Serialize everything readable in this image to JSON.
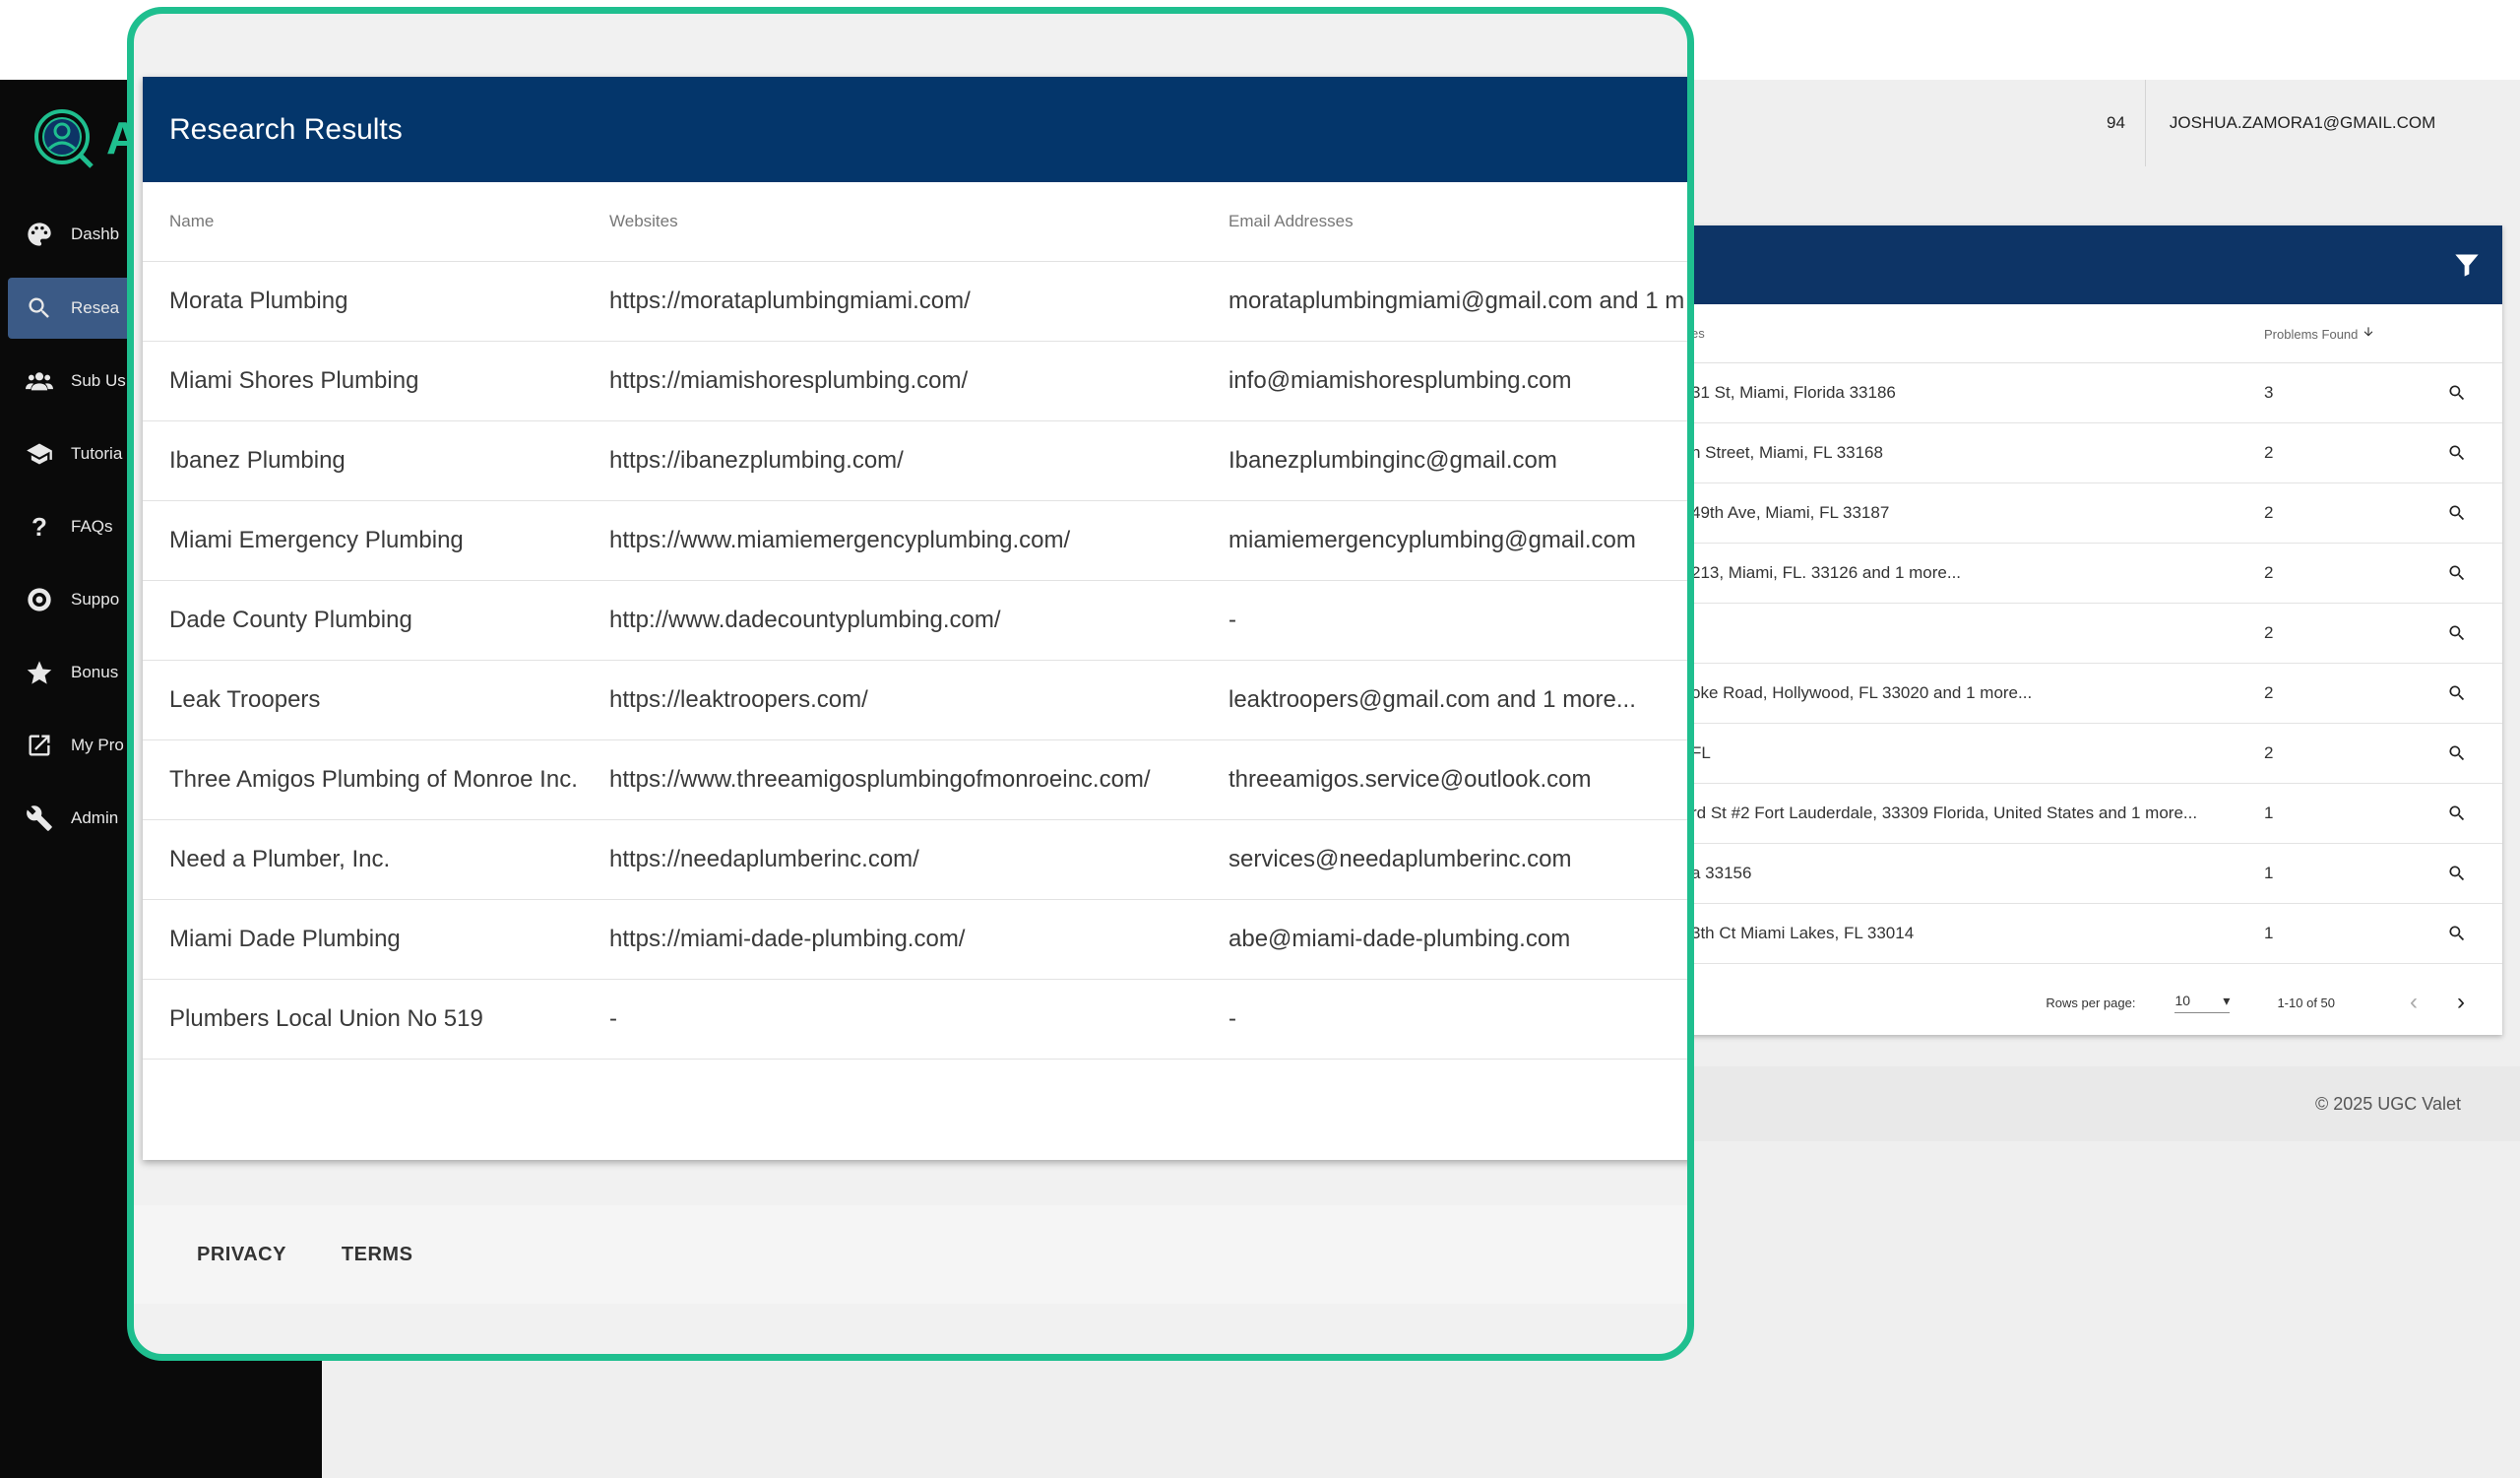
{
  "brand": {
    "logo_letter": "A",
    "accent_color": "#1fbf8f",
    "header_color": "#04366b"
  },
  "topbar": {
    "credits": "94",
    "user_email": "JOSHUA.ZAMORA1@GMAIL.COM"
  },
  "sidebar": {
    "items": [
      {
        "label": "Dashb",
        "icon": "palette-icon"
      },
      {
        "label": "Resea",
        "icon": "search-icon",
        "active": true
      },
      {
        "label": "Sub Us",
        "icon": "users-icon"
      },
      {
        "label": "Tutoria",
        "icon": "graduation-cap-icon"
      },
      {
        "label": "FAQs",
        "icon": "question-icon"
      },
      {
        "label": "Suppo",
        "icon": "lifebuoy-icon"
      },
      {
        "label": "Bonus",
        "icon": "star-icon"
      },
      {
        "label": "My Pro",
        "icon": "external-link-icon"
      },
      {
        "label": "Admin",
        "icon": "tools-icon"
      }
    ]
  },
  "background_table": {
    "col_address": "es",
    "col_problems": "Problems Found",
    "rows": [
      {
        "address": "31 St, Miami, Florida 33186",
        "problems": "3"
      },
      {
        "address": "h Street, Miami, FL 33168",
        "problems": "2"
      },
      {
        "address": "49th Ave, Miami, FL 33187",
        "problems": "2"
      },
      {
        "address": "213, Miami, FL. 33126 and 1 more...",
        "problems": "2"
      },
      {
        "address": "",
        "problems": "2"
      },
      {
        "address": "oke Road, Hollywood, FL 33020 and 1 more...",
        "problems": "2"
      },
      {
        "address": "FL",
        "problems": "2"
      },
      {
        "address": "rd St #2 Fort Lauderdale, 33309 Florida, United States and 1 more...",
        "problems": "1"
      },
      {
        "address": "a 33156",
        "problems": "1"
      },
      {
        "address": "3th Ct Miami Lakes, FL 33014",
        "problems": "1"
      }
    ],
    "pagination": {
      "rows_per_page_label": "Rows per page:",
      "rows_per_page": "10",
      "range": "1-10 of 50"
    },
    "copyright": "© 2025 UGC Valet"
  },
  "modal": {
    "title": "Research Results",
    "columns": {
      "name": "Name",
      "websites": "Websites",
      "emails": "Email Addresses"
    },
    "rows": [
      {
        "name": "Morata Plumbing",
        "website": "https://morataplumbingmiami.com/",
        "email": "morataplumbingmiami@gmail.com and 1 m"
      },
      {
        "name": "Miami Shores Plumbing",
        "website": "https://miamishoresplumbing.com/",
        "email": "info@miamishoresplumbing.com"
      },
      {
        "name": "Ibanez Plumbing",
        "website": "https://ibanezplumbing.com/",
        "email": "Ibanezplumbinginc@gmail.com"
      },
      {
        "name": "Miami Emergency Plumbing",
        "website": "https://www.miamiemergencyplumbing.com/",
        "email": "miamiemergencyplumbing@gmail.com"
      },
      {
        "name": "Dade County Plumbing",
        "website": "http://www.dadecountyplumbing.com/",
        "email": "-"
      },
      {
        "name": "Leak Troopers",
        "website": "https://leaktroopers.com/",
        "email": "leaktroopers@gmail.com and 1 more..."
      },
      {
        "name": "Three Amigos Plumbing of Monroe Inc.",
        "website": "https://www.threeamigosplumbingofmonroeinc.com/",
        "email": "threeamigos.service@outlook.com"
      },
      {
        "name": "Need a Plumber, Inc.",
        "website": "https://needaplumberinc.com/",
        "email": "services@needaplumberinc.com"
      },
      {
        "name": "Miami Dade Plumbing",
        "website": "https://miami-dade-plumbing.com/",
        "email": "abe@miami-dade-plumbing.com"
      },
      {
        "name": "Plumbers Local Union No 519",
        "website": "-",
        "email": "-"
      }
    ]
  },
  "footer": {
    "privacy": "PRIVACY",
    "terms": "TERMS"
  }
}
